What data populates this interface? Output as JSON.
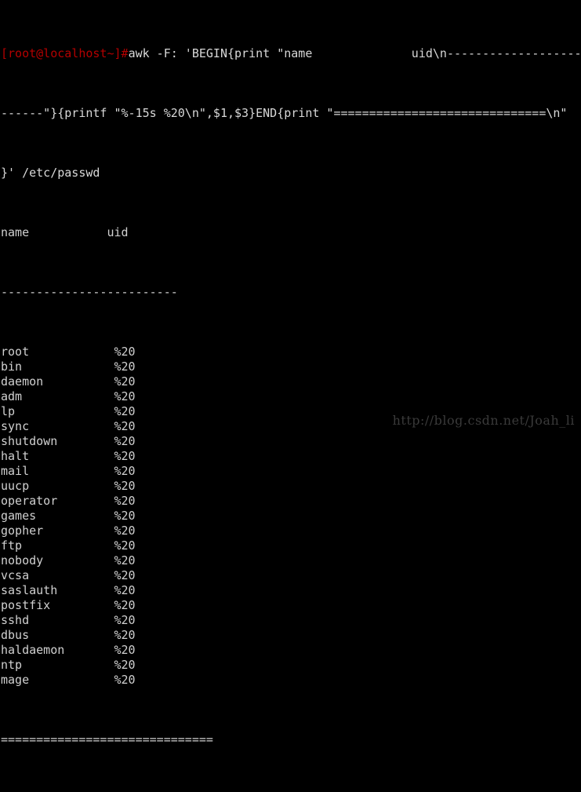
{
  "terminal": {
    "background_color": "#000000",
    "foreground_color": "#d0d0d0",
    "prompt_color": "#b40000",
    "prompt": "[root@localhost~]#",
    "command_line1": "awk -F: 'BEGIN{print \"name              uid\\n-------------------------",
    "command_line2": "------\"}{printf \"%-15s %20\\n\",$1,$3}END{print \"==============================\\n\"",
    "command_line3": "}' /etc/passwd",
    "header_row": "name           uid",
    "header_rule": "-------------------------",
    "footer_rule": "==============================",
    "columns": [
      "name",
      "uid"
    ],
    "rows": [
      {
        "name": "root",
        "uid": "%20"
      },
      {
        "name": "bin",
        "uid": "%20"
      },
      {
        "name": "daemon",
        "uid": "%20"
      },
      {
        "name": "adm",
        "uid": "%20"
      },
      {
        "name": "lp",
        "uid": "%20"
      },
      {
        "name": "sync",
        "uid": "%20"
      },
      {
        "name": "shutdown",
        "uid": "%20"
      },
      {
        "name": "halt",
        "uid": "%20"
      },
      {
        "name": "mail",
        "uid": "%20"
      },
      {
        "name": "uucp",
        "uid": "%20"
      },
      {
        "name": "operator",
        "uid": "%20"
      },
      {
        "name": "games",
        "uid": "%20"
      },
      {
        "name": "gopher",
        "uid": "%20"
      },
      {
        "name": "ftp",
        "uid": "%20"
      },
      {
        "name": "nobody",
        "uid": "%20"
      },
      {
        "name": "vcsa",
        "uid": "%20"
      },
      {
        "name": "saslauth",
        "uid": "%20"
      },
      {
        "name": "postfix",
        "uid": "%20"
      },
      {
        "name": "sshd",
        "uid": "%20"
      },
      {
        "name": "dbus",
        "uid": "%20"
      },
      {
        "name": "haldaemon",
        "uid": "%20"
      },
      {
        "name": "ntp",
        "uid": "%20"
      },
      {
        "name": "mage",
        "uid": "%20"
      }
    ]
  },
  "watermark": {
    "text": "http://blog.csdn.net/Joah_li",
    "color": "#3a3a3a"
  }
}
